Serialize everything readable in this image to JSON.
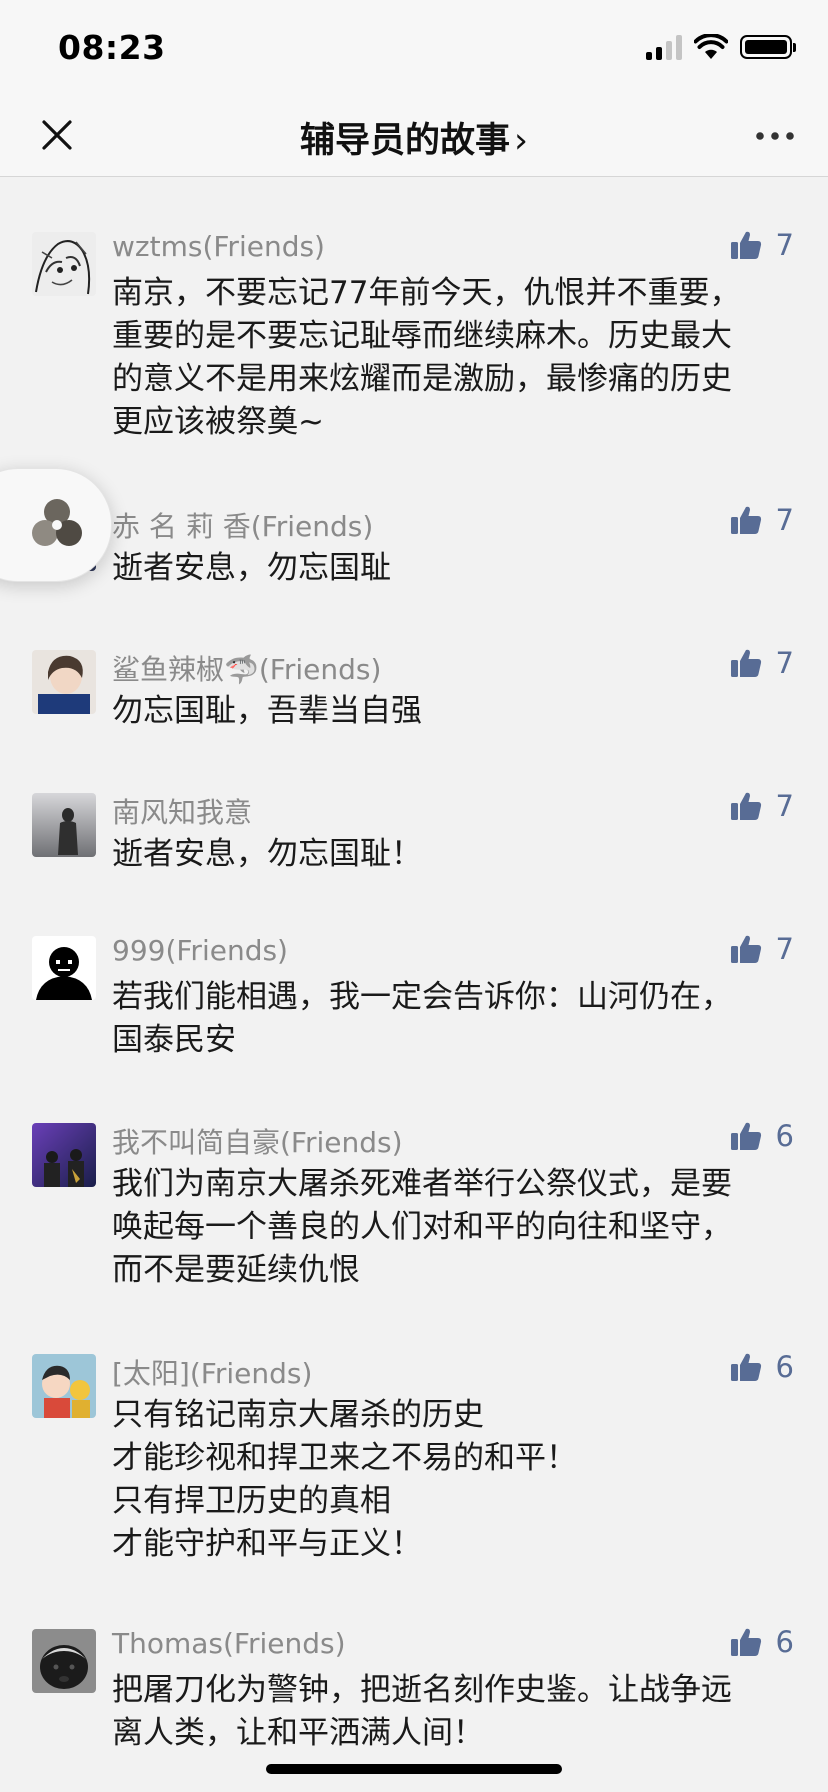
{
  "status": {
    "time": "08:23"
  },
  "nav": {
    "title": "辅导员的故事",
    "chevron": "›"
  },
  "comments": [
    {
      "name": "wztms(Friends)",
      "likes": "7",
      "text": "南京，不要忘记77年前今天，仇恨并不重要，\n重要的是不要忘记耻辱而继续麻木。历史最大\n的意义不是用来炫耀而是激励，最惨痛的历史\n更应该被祭奠~"
    },
    {
      "name": "赤 名 莉 香(Friends)",
      "likes": "7",
      "text": "逝者安息，勿忘国耻"
    },
    {
      "name": "鲨鱼辣椒🦈(Friends)",
      "likes": "7",
      "text": "勿忘国耻，吾辈当自强"
    },
    {
      "name": "南风知我意",
      "likes": "7",
      "text": "逝者安息，勿忘国耻！"
    },
    {
      "name": "999(Friends)",
      "likes": "7",
      "text": "若我们能相遇，我一定会告诉你：山河仍在，\n国泰民安"
    },
    {
      "name": "我不叫简自豪(Friends)",
      "likes": "6",
      "text": "我们为南京大屠杀死难者举行公祭仪式，是要\n唤起每一个善良的人们对和平的向往和坚守，\n而不是要延续仇恨"
    },
    {
      "name": "[太阳](Friends)",
      "likes": "6",
      "text": "只有铭记南京大屠杀的历史\n才能珍视和捍卫来之不易的和平！\n只有捍卫历史的真相\n才能守护和平与正义！"
    },
    {
      "name": "Thomas(Friends)",
      "likes": "6",
      "text": "把屠刀化为警钟，把逝名刻作史鉴。让战争远\n离人类，让和平洒满人间！"
    }
  ],
  "colors": {
    "like": "#586c95",
    "name": "#8a8a8a",
    "background": "#f2f2f2"
  },
  "icons": {
    "like": "thumbs-up-icon",
    "close": "close-icon",
    "more": "more-icon"
  }
}
